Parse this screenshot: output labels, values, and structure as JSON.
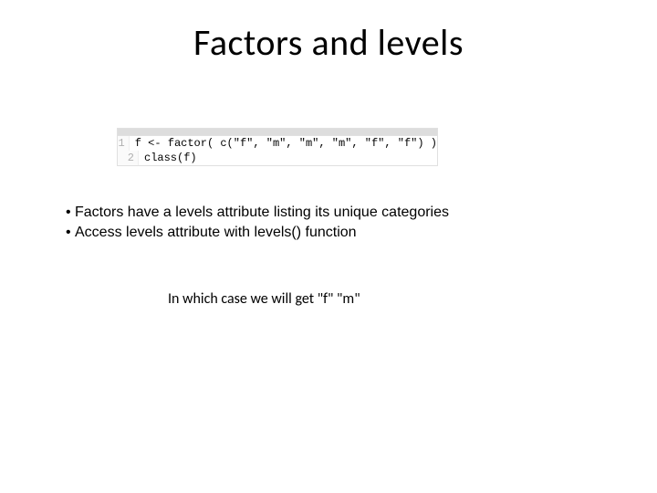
{
  "title": "Factors and levels",
  "code": {
    "lines": [
      {
        "n": "1",
        "text": "f <- factor( c(\"f\", \"m\", \"m\", \"m\", \"f\", \"f\") )"
      },
      {
        "n": "2",
        "text": "class(f)"
      }
    ]
  },
  "bullets": [
    "Factors have a levels attribute listing its unique categories",
    "Access levels attribute with levels() function"
  ],
  "caption": "In which case we will get  \"f\"  \"m\""
}
